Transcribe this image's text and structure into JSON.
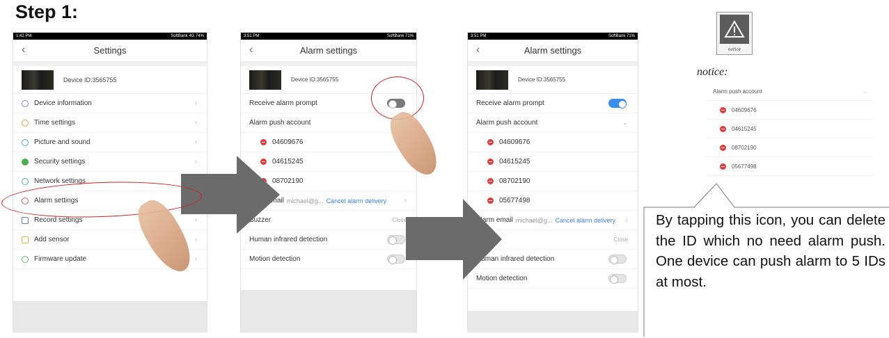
{
  "step_title": "Step 1:",
  "phone1": {
    "status_time": "1:42 PM",
    "status_right": "SoftBank 4G 74%",
    "title": "Settings",
    "device_id": "Device ID:3565755",
    "items": [
      {
        "label": "Device information",
        "icon": "info-icon"
      },
      {
        "label": "Time settings",
        "icon": "clock-icon"
      },
      {
        "label": "Picture and sound",
        "icon": "picture-icon"
      },
      {
        "label": "Security settings",
        "icon": "shield-icon"
      },
      {
        "label": "Network settings",
        "icon": "wifi-icon"
      },
      {
        "label": "Alarm settings",
        "icon": "bell-icon"
      },
      {
        "label": "Record settings",
        "icon": "record-icon"
      },
      {
        "label": "Add sensor",
        "icon": "sensor-icon"
      },
      {
        "label": "Firmware update",
        "icon": "firmware-icon"
      }
    ]
  },
  "phone2": {
    "status_time": "3:51 PM",
    "status_right": "SoftBank 71%",
    "title": "Alarm settings",
    "device_id": "Device ID:3565755",
    "receive_alarm_prompt": "Receive alarm prompt",
    "alarm_push_account": "Alarm push account",
    "accounts": [
      "04609676",
      "04615245",
      "08702190"
    ],
    "email_label": "email",
    "email_value": "michael@g...",
    "cancel_delivery": "Cancel alarm delivery",
    "buzzer": "Buzzer",
    "buzzer_value": "Close",
    "human_infrared": "Human infrared detection",
    "motion_detection": "Motion detection",
    "toggle_receive": false
  },
  "phone3": {
    "status_time": "3:51 PM",
    "status_right": "SoftBank 71%",
    "title": "Alarm settings",
    "device_id": "Device ID:3565755",
    "receive_alarm_prompt": "Receive alarm prompt",
    "alarm_push_account": "Alarm push account",
    "accounts": [
      "04609676",
      "04615245",
      "08702190",
      "05677498"
    ],
    "email_label": "Alarm email",
    "email_value": "michael@g...",
    "cancel_delivery": "Cancel alarm delivery",
    "buzzer_value": "Close",
    "human_infrared": "Human infrared detection",
    "motion_detection": "Motion detection",
    "toggle_receive": true
  },
  "notice": {
    "icon_caption": "notice",
    "label": "notice:",
    "panel_header": "Alarm push account",
    "accounts": [
      "04609676",
      "04615245",
      "08702190",
      "05677498"
    ],
    "callout_text": "By tapping this icon,  you can delete the ID which no need  alarm  push.  One device can push alarm to 5 IDs at most."
  },
  "colors": {
    "arrow": "#6b6b6b",
    "highlight": "#d21f1f",
    "toggle_on": "#3b8df0",
    "delete": "#e23b3b"
  }
}
